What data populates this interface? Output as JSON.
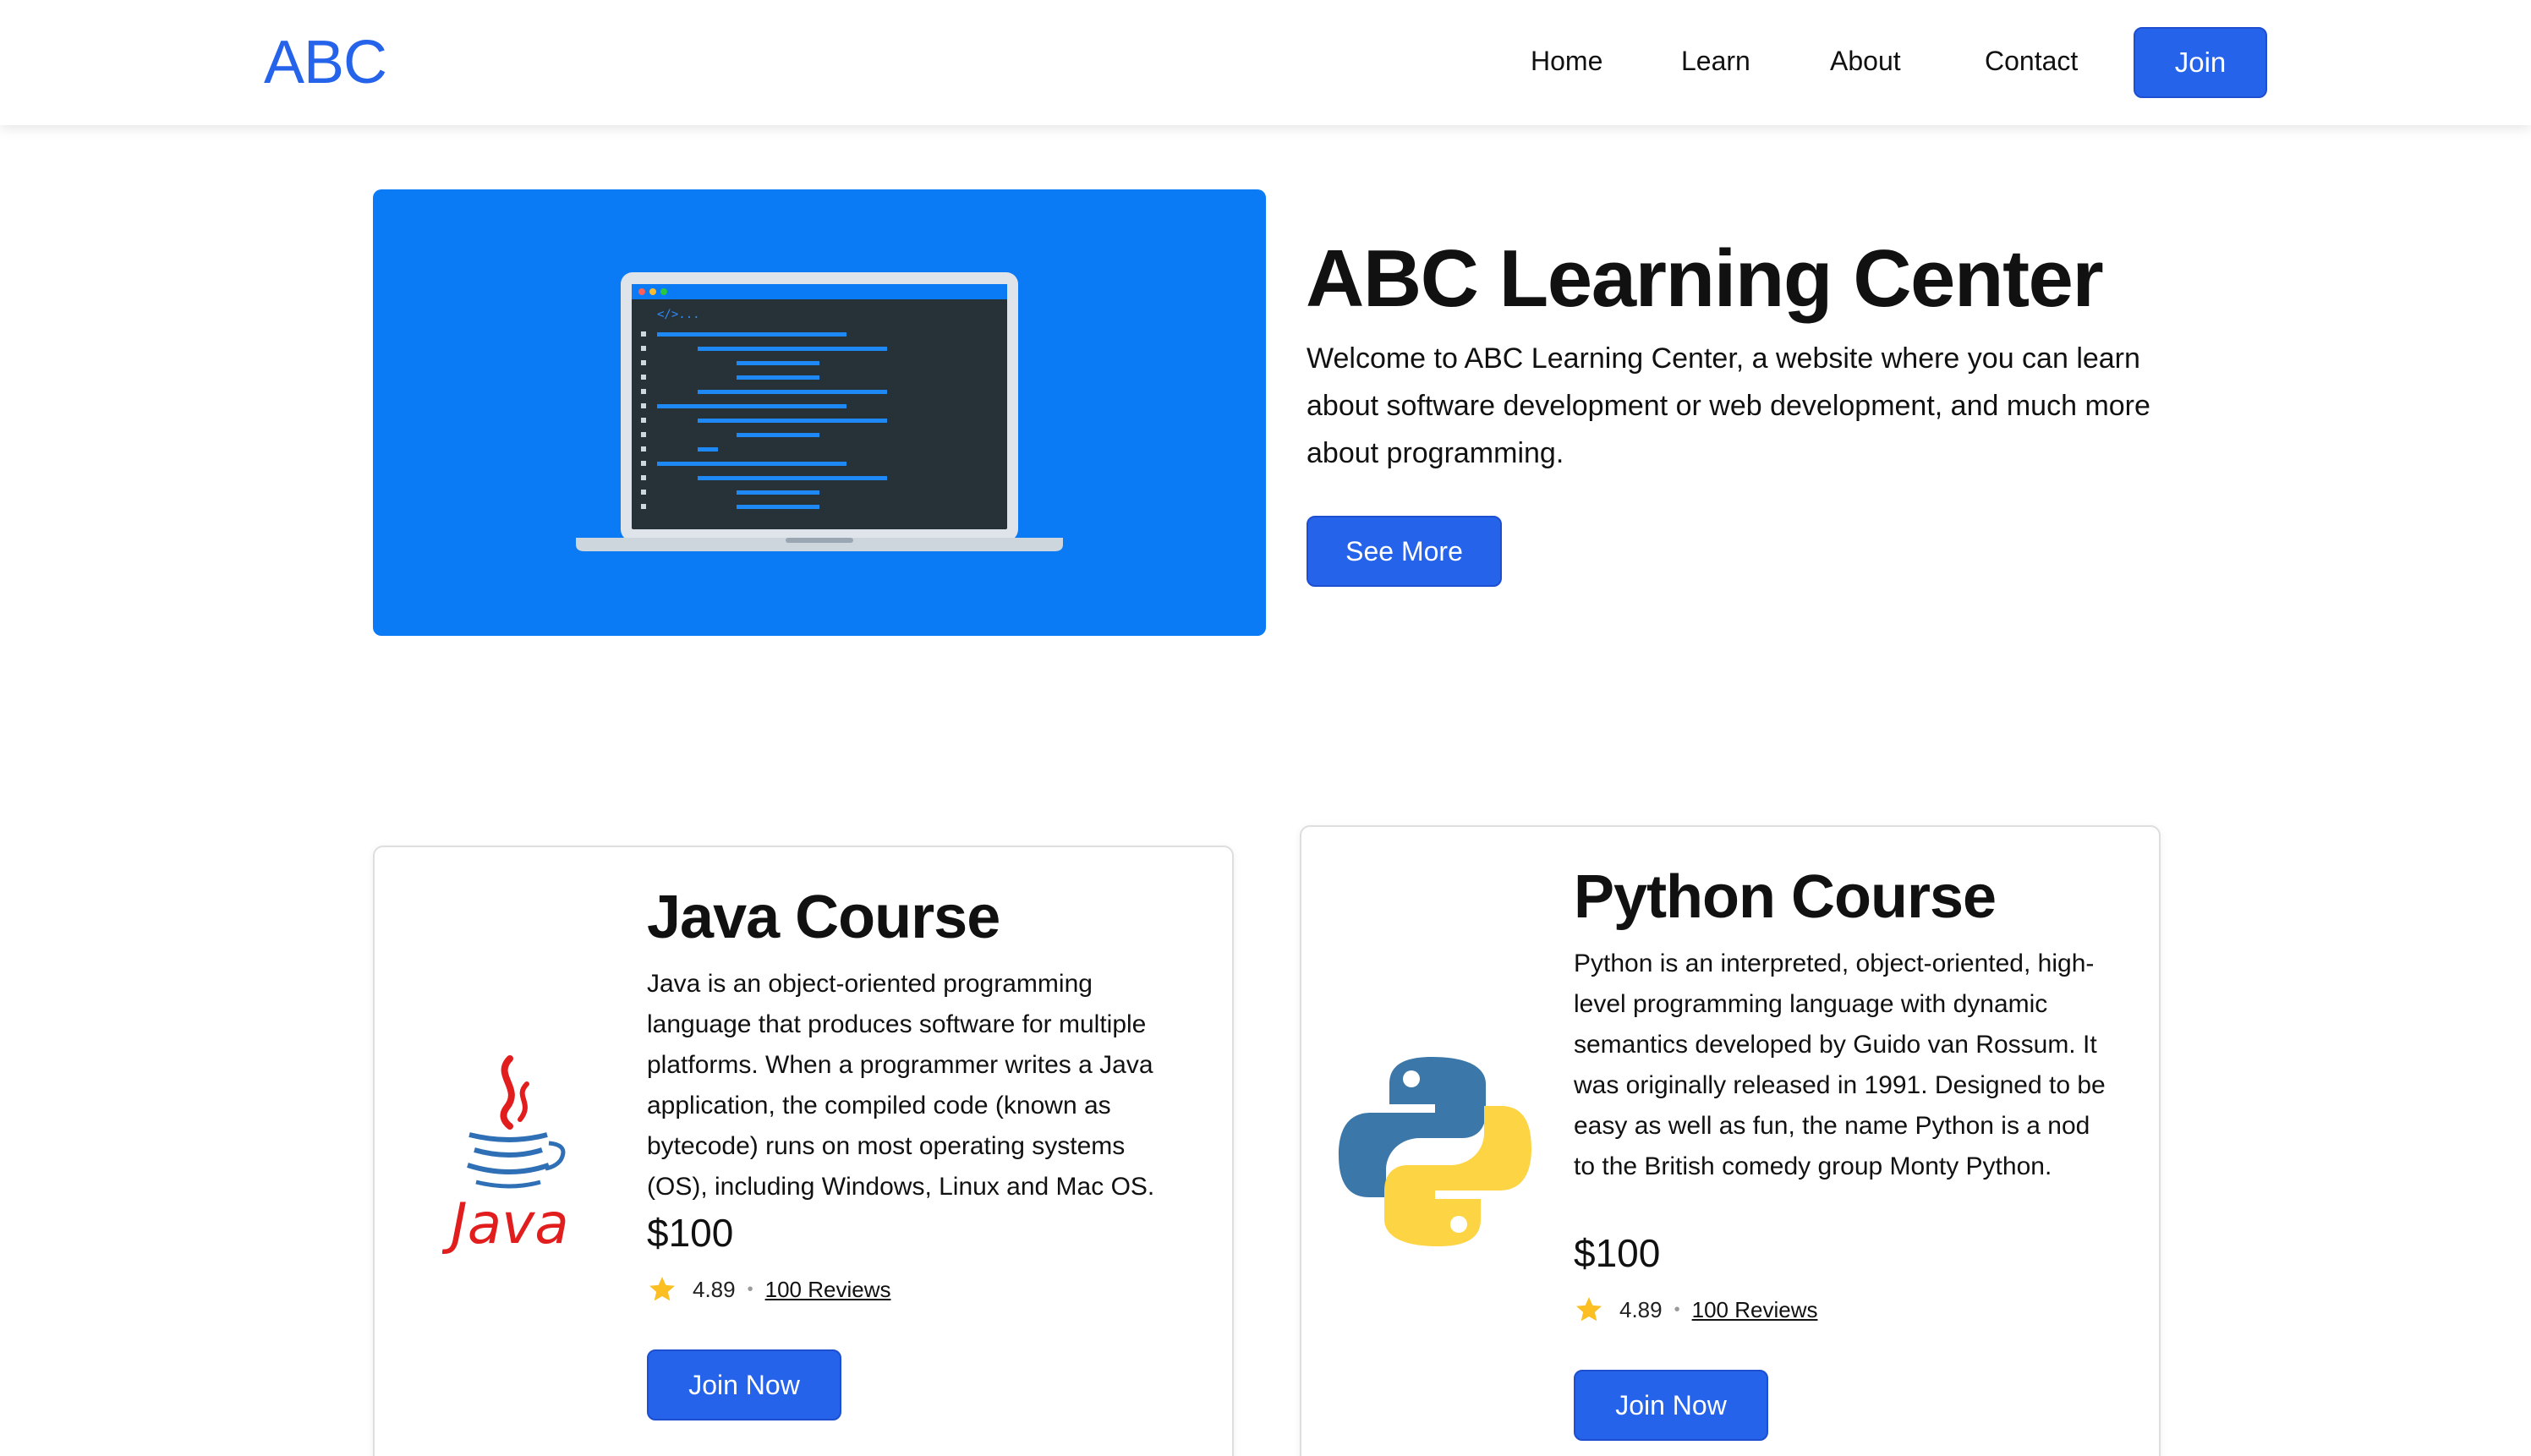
{
  "nav": {
    "brand": "ABC",
    "links": [
      "Home",
      "Learn",
      "About",
      "Contact"
    ],
    "join_label": "Join"
  },
  "hero": {
    "illustration_icon": "laptop-code-icon",
    "code_tag": "</>...",
    "title": "ABC Learning Center",
    "description": "Welcome to ABC Learning Center, a website where you can learn about software development or web development, and much more about programming.",
    "button_label": "See More",
    "background_color": "#0a7bf5"
  },
  "courses": [
    {
      "logo_icon": "java-logo-icon",
      "logo_text": "Java",
      "title": "Java Course",
      "description": "Java is an object-oriented programming language that produces software for multiple platforms. When a programmer writes a Java application, the compiled code (known as bytecode) runs on most operating systems (OS), including Windows, Linux and Mac OS.",
      "price": "$100",
      "rating": "4.89",
      "separator": "•",
      "reviews": "100 Reviews",
      "button_label": "Join Now"
    },
    {
      "logo_icon": "python-logo-icon",
      "title": "Python Course",
      "description": "Python is an interpreted, object-oriented, high-level programming language with dynamic semantics developed by Guido van Rossum. It was originally released in 1991. Designed to be easy as well as fun, the name Python is a nod to the British comedy group Monty Python.",
      "price": "$100",
      "rating": "4.89",
      "separator": "•",
      "reviews": "100 Reviews",
      "button_label": "Join Now"
    }
  ],
  "colors": {
    "accent": "#2563eb",
    "star": "#fbbf24",
    "java_red": "#e11d1d",
    "java_blue": "#2f6fb6",
    "python_blue": "#3b77a8",
    "python_yellow": "#fdd443"
  }
}
